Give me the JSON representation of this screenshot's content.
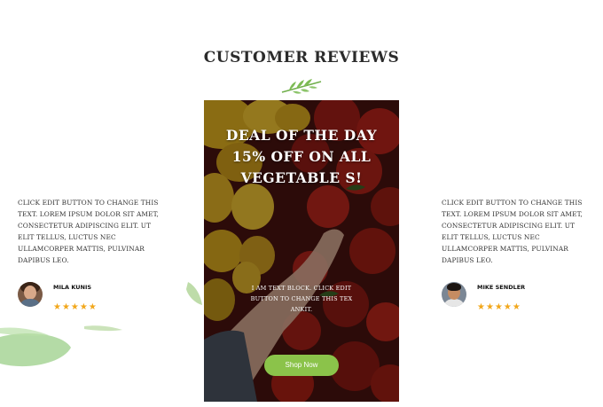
{
  "section": {
    "title": "CUSTOMER REVIEWS"
  },
  "reviews": [
    {
      "text": "Click edit button to change this text. Lorem ipsum dolor sit amet, consectetur adipiscing elit. Ut elit tellus, luctus nec ullamcorper mattis, pulvinar dapibus leo.",
      "name": "Mila Kunis",
      "stars": "★★★★★",
      "rating": 5
    },
    {
      "text": "Click edit button to change this text. Lorem ipsum dolor sit amet, consectetur adipiscing elit. Ut elit tellus, luctus nec ullamcorper mattis, pulvinar dapibus leo.",
      "name": "Mike Sendler",
      "stars": "★★★★★",
      "rating": 5
    }
  ],
  "promo": {
    "title": "DEAL OF THE DAY 15% OFF ON ALL VEGETABLE S!",
    "body": "I am text block. Click edit button to change this tex ankit.",
    "button_label": "Shop Now"
  },
  "colors": {
    "accent_green": "#8bc34a",
    "star": "#f2a71b",
    "heading": "#2b2b2b"
  },
  "icons": {
    "ornament": "leaf-ornament-icon",
    "rating": "star-icon"
  }
}
